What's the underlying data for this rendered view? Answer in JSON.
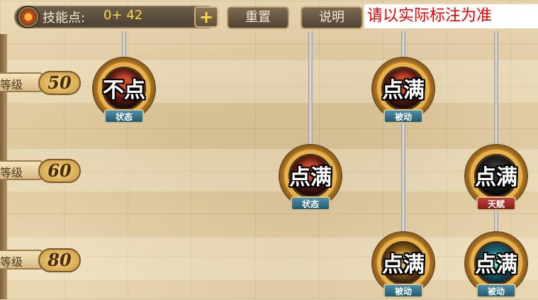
{
  "header": {
    "points_label": "技能点:",
    "points_value": "0+ 42",
    "plus_label": "+",
    "reset_label": "重置",
    "info_label": "说明",
    "notice": "请以实际标注为准"
  },
  "levels": [
    {
      "prefix": "等级",
      "value": "50"
    },
    {
      "prefix": "等级",
      "value": "60"
    },
    {
      "prefix": "等级",
      "value": "80"
    }
  ],
  "skills": [
    {
      "caption": "不点",
      "type": "状态",
      "icon": "skill-red-crest-icon"
    },
    {
      "caption": "点满",
      "type": "被动",
      "icon": "skill-red-crest-icon"
    },
    {
      "caption": "点满",
      "type": "状态",
      "icon": "skill-red-crest-icon"
    },
    {
      "caption": "点满",
      "type": "天赋",
      "icon": "skill-dark-knight-icon"
    },
    {
      "caption": "点满",
      "type": "被动",
      "icon": "skill-golden-star-icon"
    },
    {
      "caption": "点满",
      "type": "被动",
      "icon": "skill-teal-orb-icon"
    }
  ],
  "colors": {
    "notice_text": "#e00000",
    "points_value": "#ffd94a",
    "tag_blue": "#25596d",
    "tag_red": "#7e1f19"
  }
}
